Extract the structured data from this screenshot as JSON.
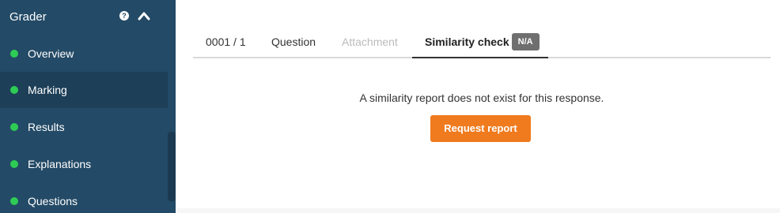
{
  "sidebar": {
    "title": "Grader",
    "items": [
      {
        "label": "Overview"
      },
      {
        "label": "Marking"
      },
      {
        "label": "Results"
      },
      {
        "label": "Explanations"
      },
      {
        "label": "Questions"
      }
    ],
    "active_item": "Marking",
    "dot_color": "#2ecc55",
    "background": "#234a66"
  },
  "tabs": [
    {
      "label": "0001 / 1",
      "state": "normal"
    },
    {
      "label": "Question",
      "state": "normal"
    },
    {
      "label": "Attachment",
      "state": "disabled"
    },
    {
      "label": "Similarity check",
      "state": "active",
      "badge": "N/A"
    }
  ],
  "main": {
    "message": "A similarity report does not exist for this response.",
    "button_label": "Request report",
    "button_color": "#f07a1e"
  },
  "icons": {
    "help": "question-circle-icon",
    "collapse": "chevron-up-icon"
  }
}
